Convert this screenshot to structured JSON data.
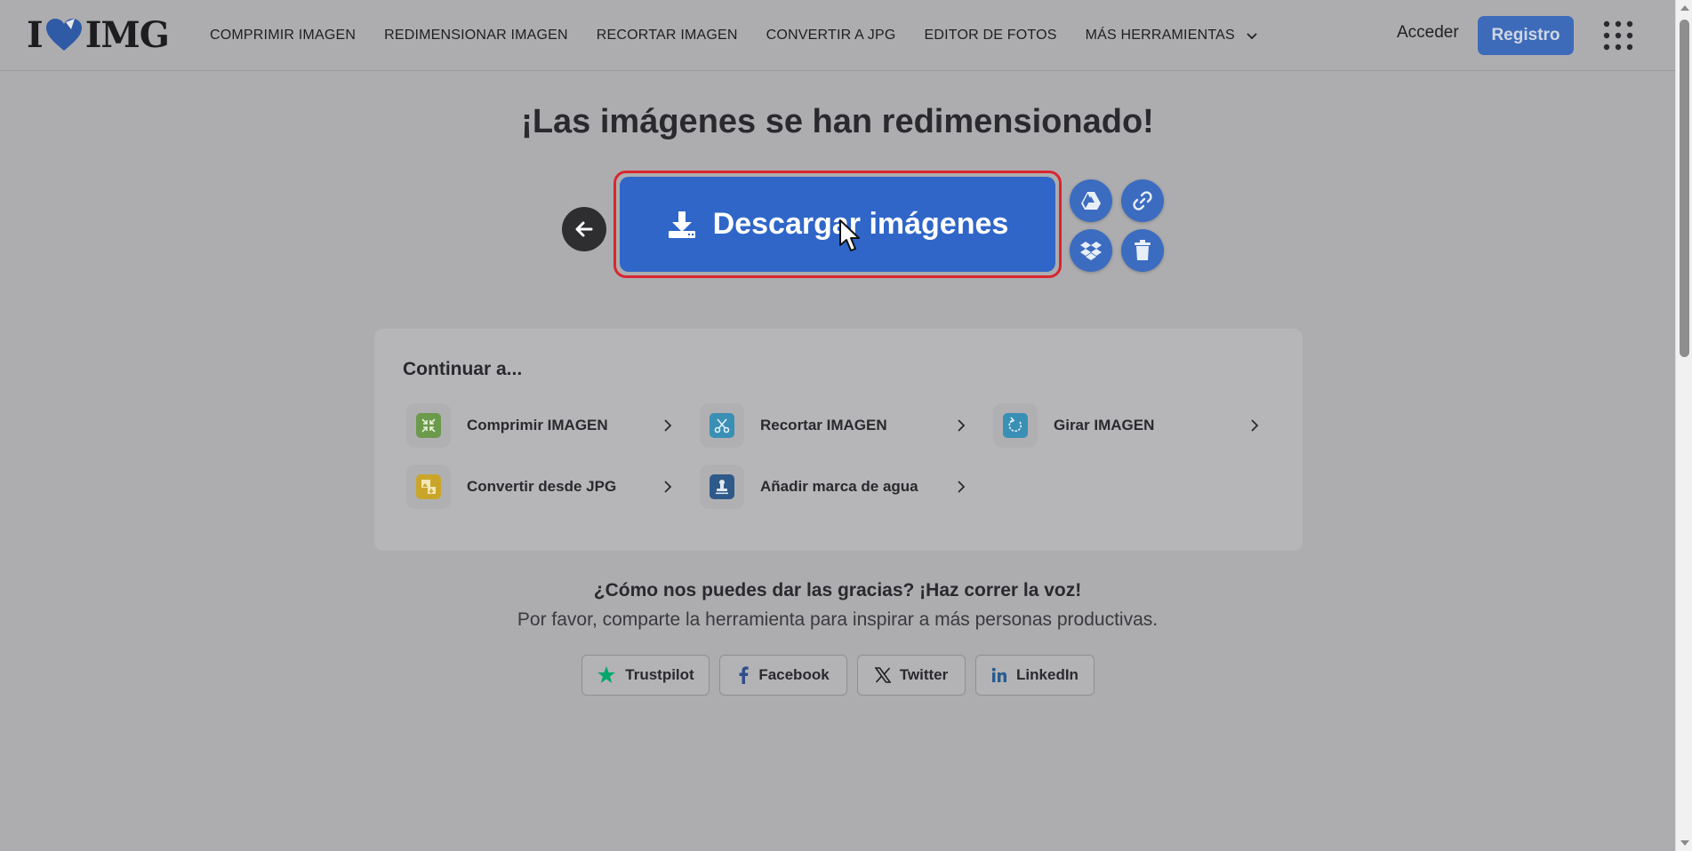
{
  "logo": {
    "left": "I",
    "right": "IMG"
  },
  "nav": [
    {
      "label": "COMPRIMIR IMAGEN"
    },
    {
      "label": "REDIMENSIONAR IMAGEN"
    },
    {
      "label": "RECORTAR IMAGEN"
    },
    {
      "label": "CONVERTIR A JPG"
    },
    {
      "label": "EDITOR DE FOTOS"
    },
    {
      "label": "MÁS HERRAMIENTAS"
    }
  ],
  "auth": {
    "login": "Acceder",
    "signup": "Registro"
  },
  "title": "¡Las imágenes se han redimensionado!",
  "download": {
    "label": "Descargar imágenes"
  },
  "continue": {
    "title": "Continuar a...",
    "tools": [
      {
        "label": "Comprimir IMAGEN",
        "icon": "compress-icon",
        "color": "#6a9a4a"
      },
      {
        "label": "Recortar IMAGEN",
        "icon": "crop-icon",
        "color": "#3a8fb5"
      },
      {
        "label": "Girar IMAGEN",
        "icon": "rotate-icon",
        "color": "#3a8fb5"
      },
      {
        "label": "Convertir desde JPG",
        "icon": "convert-icon",
        "color": "#c9a62a"
      },
      {
        "label": "Añadir marca de agua",
        "icon": "stamp-icon",
        "color": "#2e5a8a"
      }
    ]
  },
  "share": {
    "title": "¿Cómo nos puedes dar las gracias? ¡Haz correr la voz!",
    "subtitle": "Por favor, comparte la herramienta para inspirar a más personas productivas.",
    "buttons": [
      {
        "label": "Trustpilot",
        "icon": "star-icon",
        "color": "#00a86b"
      },
      {
        "label": "Facebook",
        "icon": "facebook-icon",
        "color": "#2f4f8a"
      },
      {
        "label": "Twitter",
        "icon": "x-icon",
        "color": "#1f1f22"
      },
      {
        "label": "LinkedIn",
        "icon": "linkedin-icon",
        "color": "#2a5b8f"
      }
    ]
  },
  "colors": {
    "accent": "#2f66c8",
    "highlight": "#d9262e",
    "background": "#adadb0"
  }
}
